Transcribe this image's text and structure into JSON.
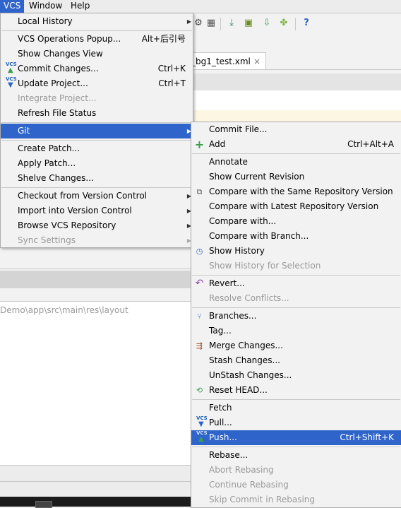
{
  "menubar": {
    "items": [
      {
        "label": "VCS"
      },
      {
        "label": "Window"
      },
      {
        "label": "Help"
      }
    ]
  },
  "editor": {
    "tab_label": "_bg1_test.xml",
    "tab_close": "×"
  },
  "project": {
    "path": "Demo\\app\\src\\main\\res\\layout"
  },
  "vcs_menu": {
    "items": [
      {
        "label": "Local History",
        "submenu": true
      },
      {
        "label": "VCS Operations Popup...",
        "shortcut": "Alt+后引号"
      },
      {
        "label": "Show Changes View"
      },
      {
        "label": "Commit Changes...",
        "shortcut": "Ctrl+K"
      },
      {
        "label": "Update Project...",
        "shortcut": "Ctrl+T"
      },
      {
        "label": "Integrate Project..."
      },
      {
        "label": "Refresh File Status"
      },
      {
        "label": "Git",
        "submenu": true
      },
      {
        "label": "Create Patch..."
      },
      {
        "label": "Apply Patch..."
      },
      {
        "label": "Shelve Changes..."
      },
      {
        "label": "Checkout from Version Control",
        "submenu": true
      },
      {
        "label": "Import into Version Control",
        "submenu": true
      },
      {
        "label": "Browse VCS Repository",
        "submenu": true
      },
      {
        "label": "Sync Settings",
        "submenu": true
      }
    ]
  },
  "git_menu": {
    "items": [
      {
        "label": "Commit File..."
      },
      {
        "label": "Add",
        "shortcut": "Ctrl+Alt+A"
      },
      {
        "label": "Annotate"
      },
      {
        "label": "Show Current Revision"
      },
      {
        "label": "Compare with the Same Repository Version"
      },
      {
        "label": "Compare with Latest Repository Version"
      },
      {
        "label": "Compare with..."
      },
      {
        "label": "Compare with Branch..."
      },
      {
        "label": "Show History"
      },
      {
        "label": "Show History for Selection"
      },
      {
        "label": "Revert..."
      },
      {
        "label": "Resolve Conflicts..."
      },
      {
        "label": "Branches..."
      },
      {
        "label": "Tag..."
      },
      {
        "label": "Merge Changes..."
      },
      {
        "label": "Stash Changes..."
      },
      {
        "label": "UnStash Changes..."
      },
      {
        "label": "Reset HEAD..."
      },
      {
        "label": "Fetch"
      },
      {
        "label": "Pull..."
      },
      {
        "label": "Push...",
        "shortcut": "Ctrl+Shift+K"
      },
      {
        "label": "Rebase..."
      },
      {
        "label": "Abort Rebasing"
      },
      {
        "label": "Continue Rebasing"
      },
      {
        "label": "Skip Commit in Rebasing"
      }
    ]
  },
  "icons": {
    "vcs_badge": "VCS",
    "arrow_right": "▶",
    "help": "?",
    "add": "+"
  },
  "colors": {
    "selection": "#2f65ca",
    "menu_bg": "#f2f2f2",
    "disabled_text": "#9a9a9a"
  }
}
